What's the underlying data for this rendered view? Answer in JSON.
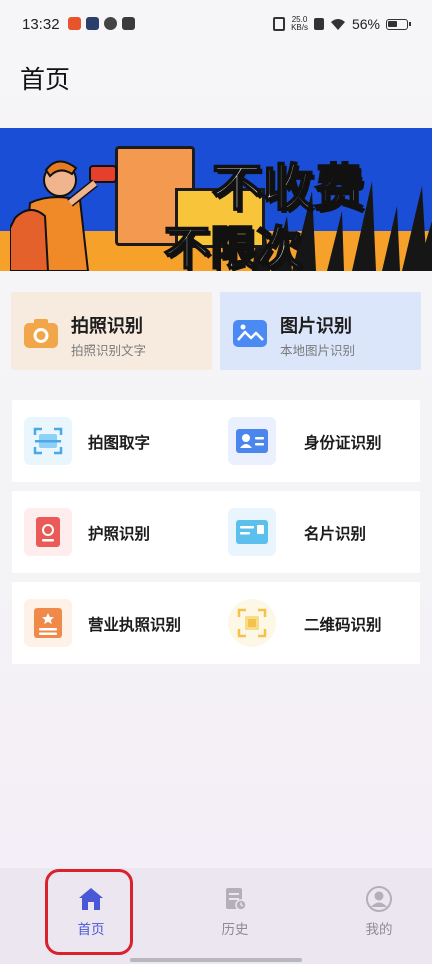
{
  "status_bar": {
    "time": "13:32",
    "net_speed_value": "25.0",
    "net_speed_unit": "KB/s",
    "battery": "56%"
  },
  "header": {
    "title": "首页"
  },
  "banner": {
    "headline": "不收费",
    "subline": "不限次"
  },
  "quick_actions": [
    {
      "title": "拍照识别",
      "subtitle": "拍照识别文字",
      "icon": "camera-icon",
      "color": "#f1a64a"
    },
    {
      "title": "图片识别",
      "subtitle": "本地图片识别",
      "icon": "image-icon",
      "color": "#4b8af2"
    }
  ],
  "grid": [
    {
      "label": "拍图取字",
      "icon": "scan-text-icon"
    },
    {
      "label": "身份证识别",
      "icon": "id-card-icon"
    },
    {
      "label": "护照识别",
      "icon": "passport-icon"
    },
    {
      "label": "名片识别",
      "icon": "business-card-icon"
    },
    {
      "label": "营业执照识别",
      "icon": "business-license-icon"
    },
    {
      "label": "二维码识别",
      "icon": "qr-code-icon"
    }
  ],
  "bottom_nav": [
    {
      "label": "首页",
      "icon": "home-icon",
      "active": true
    },
    {
      "label": "历史",
      "icon": "history-icon",
      "active": false
    },
    {
      "label": "我的",
      "icon": "profile-icon",
      "active": false
    }
  ],
  "colors": {
    "accent": "#4958d6",
    "highlight_box": "#d9222c",
    "banner_bg": "#1b4ed6"
  }
}
